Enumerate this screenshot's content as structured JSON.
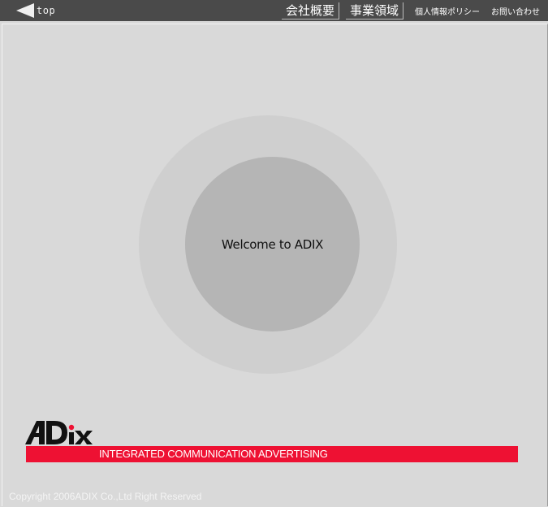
{
  "header": {
    "top_label": "top",
    "nav": [
      {
        "label": "会社概要"
      },
      {
        "label": "事業領域"
      },
      {
        "label": "個人情報ポリシー"
      },
      {
        "label": "お問い合わせ"
      }
    ]
  },
  "main": {
    "welcome_text": "Welcome to ADIX"
  },
  "brand": {
    "logo_text": "ADIX",
    "tagline": "INTEGRATED COMMUNICATION ADVERTISING"
  },
  "footer": {
    "copyright": "Copyright 2006ADIX Co.,Ltd Right Reserved"
  },
  "colors": {
    "header_bg": "#4a4a4a",
    "page_bg": "#d9d9d9",
    "accent_red": "#ee1133"
  },
  "icons": {
    "back": "back-arrow-icon"
  }
}
